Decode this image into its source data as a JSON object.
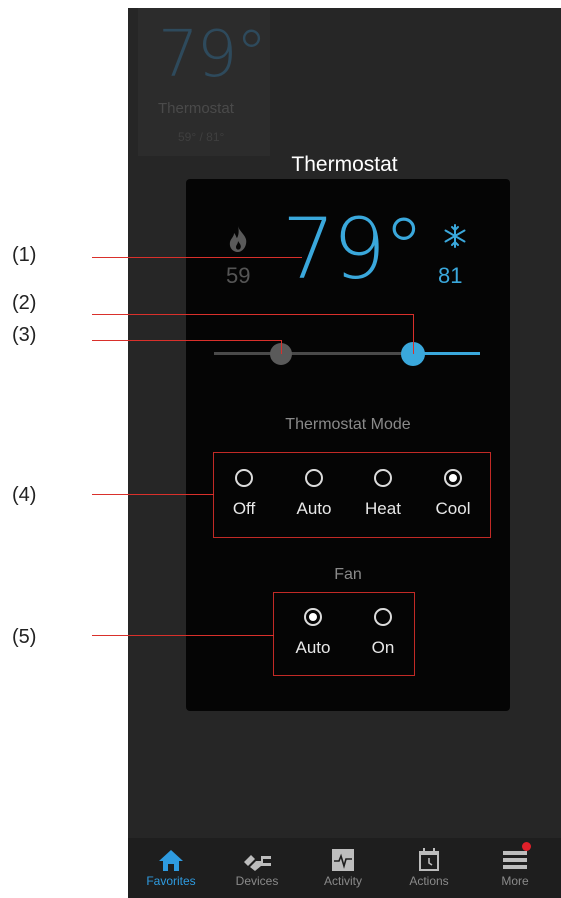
{
  "callouts": [
    "(1)",
    "(2)",
    "(3)",
    "(4)",
    "(5)"
  ],
  "background_tile": {
    "temperature": "79°",
    "label": "Thermostat",
    "range": "59° / 81°"
  },
  "dialog": {
    "title": "Thermostat",
    "current_temp": "79°",
    "heat_setpoint": "59",
    "cool_setpoint": "81",
    "mode": {
      "label": "Thermostat Mode",
      "options": [
        {
          "label": "Off",
          "selected": false
        },
        {
          "label": "Auto",
          "selected": false
        },
        {
          "label": "Heat",
          "selected": false
        },
        {
          "label": "Cool",
          "selected": true
        }
      ]
    },
    "fan": {
      "label": "Fan",
      "options": [
        {
          "label": "Auto",
          "selected": true
        },
        {
          "label": "On",
          "selected": false
        }
      ]
    }
  },
  "tabs": [
    {
      "label": "Favorites",
      "icon": "home-icon",
      "active": true
    },
    {
      "label": "Devices",
      "icon": "plug-icon",
      "active": false
    },
    {
      "label": "Activity",
      "icon": "pulse-icon",
      "active": false
    },
    {
      "label": "Actions",
      "icon": "calendar-clock-icon",
      "active": false
    },
    {
      "label": "More",
      "icon": "menu-icon",
      "active": false
    }
  ],
  "colors": {
    "accent": "#3aa8dc",
    "callout_line": "#d9302b",
    "badge": "#e0202a"
  }
}
